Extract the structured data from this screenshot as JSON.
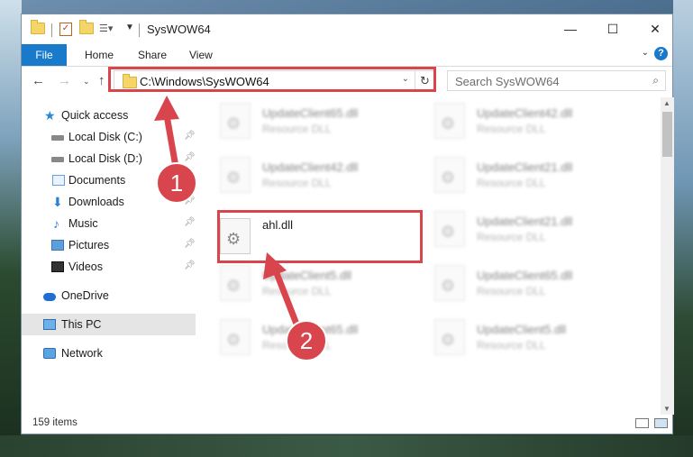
{
  "window": {
    "title": "SysWOW64",
    "controls": {
      "minimize": "—",
      "maximize": "☐",
      "close": "✕"
    }
  },
  "ribbon": {
    "file": "File",
    "tabs": [
      "Home",
      "Share",
      "View"
    ],
    "help": "?"
  },
  "address": {
    "path": "C:\\Windows\\SysWOW64",
    "search_placeholder": "Search SysWOW64"
  },
  "nav": {
    "quick_access": "Quick access",
    "items": [
      {
        "label": "Local Disk (C:)",
        "pinned": true
      },
      {
        "label": "Local Disk (D:)",
        "pinned": true
      },
      {
        "label": "Documents",
        "pinned": true
      },
      {
        "label": "Downloads",
        "pinned": true
      },
      {
        "label": "Music",
        "pinned": true
      },
      {
        "label": "Pictures",
        "pinned": true
      },
      {
        "label": "Videos",
        "pinned": true
      }
    ],
    "onedrive": "OneDrive",
    "this_pc": "This PC",
    "network": "Network"
  },
  "files": [
    {
      "name": "UpdateClient65.dll",
      "type": "Resource DLL"
    },
    {
      "name": "UpdateClient42.dll",
      "type": "Resource DLL"
    },
    {
      "name": "UpdateClient42.dll",
      "type": "Resource DLL"
    },
    {
      "name": "UpdateClient21.dll",
      "type": "Resource DLL"
    },
    {
      "name": "ahl.dll",
      "type": ""
    },
    {
      "name": "UpdateClient21.dll",
      "type": "Resource DLL"
    },
    {
      "name": "UpdateClient5.dll",
      "type": "Resource DLL"
    },
    {
      "name": "UpdateClient65.dll",
      "type": "Resource DLL"
    },
    {
      "name": "UpdateClient65.dll",
      "type": "Resource DLL"
    },
    {
      "name": "UpdateClient5.dll",
      "type": "Resource DLL"
    }
  ],
  "status": {
    "items": "159 items"
  },
  "callouts": {
    "one": "1",
    "two": "2"
  },
  "colors": {
    "accent": "#1979ca",
    "highlight": "#d9454c"
  }
}
